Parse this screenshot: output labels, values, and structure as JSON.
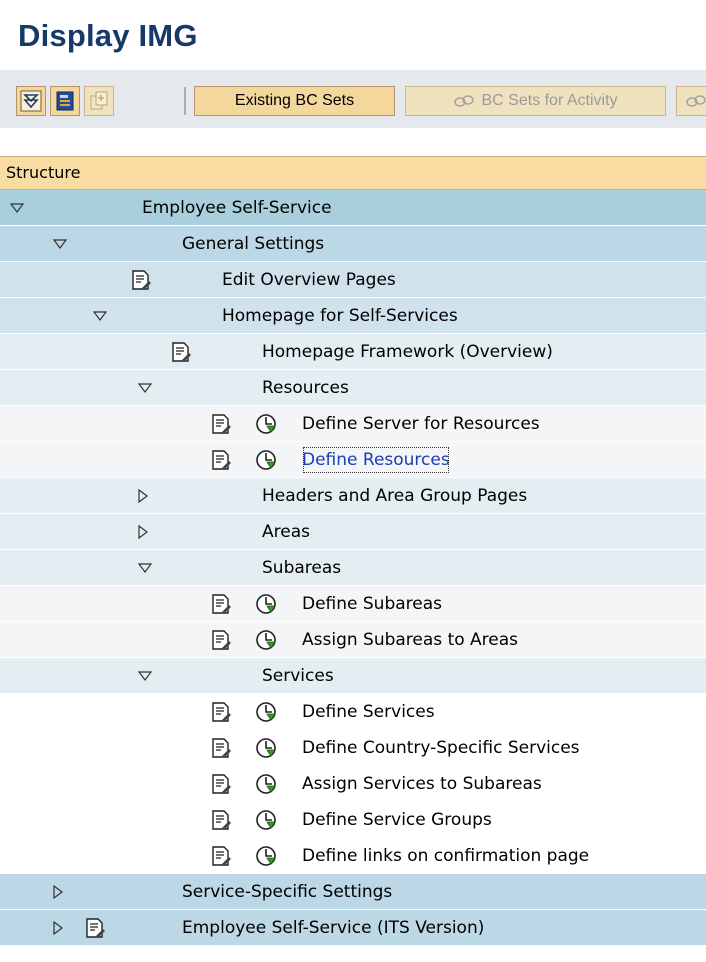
{
  "page": {
    "title": "Display IMG"
  },
  "toolbar": {
    "existing_bc_sets": "Existing BC Sets",
    "bc_sets_for_activity": "BC Sets for Activity"
  },
  "tree": {
    "header": "Structure",
    "rows": [
      {
        "label": "Employee Self-Service",
        "expander": "expanded",
        "doc": false,
        "exec": false
      },
      {
        "label": "General Settings",
        "expander": "expanded",
        "doc": false,
        "exec": false
      },
      {
        "label": "Edit Overview Pages",
        "expander": "none",
        "doc": true,
        "exec": false
      },
      {
        "label": "Homepage for Self-Services",
        "expander": "expanded",
        "doc": false,
        "exec": false
      },
      {
        "label": "Homepage Framework (Overview)",
        "expander": "none",
        "doc": true,
        "exec": false
      },
      {
        "label": "Resources",
        "expander": "expanded",
        "doc": false,
        "exec": false
      },
      {
        "label": "Define Server for Resources",
        "expander": "none",
        "doc": true,
        "exec": true
      },
      {
        "label": "Define Resources",
        "expander": "none",
        "doc": true,
        "exec": true,
        "selected": true
      },
      {
        "label": "Headers and Area Group Pages",
        "expander": "collapsed",
        "doc": false,
        "exec": false
      },
      {
        "label": "Areas",
        "expander": "collapsed",
        "doc": false,
        "exec": false
      },
      {
        "label": "Subareas",
        "expander": "expanded",
        "doc": false,
        "exec": false
      },
      {
        "label": "Define Subareas",
        "expander": "none",
        "doc": true,
        "exec": true
      },
      {
        "label": "Assign Subareas to Areas",
        "expander": "none",
        "doc": true,
        "exec": true
      },
      {
        "label": "Services",
        "expander": "expanded",
        "doc": false,
        "exec": false
      },
      {
        "label": "Define Services",
        "expander": "none",
        "doc": true,
        "exec": true
      },
      {
        "label": "Define Country-Specific Services",
        "expander": "none",
        "doc": true,
        "exec": true
      },
      {
        "label": "Assign Services to Subareas",
        "expander": "none",
        "doc": true,
        "exec": true
      },
      {
        "label": "Define Service Groups",
        "expander": "none",
        "doc": true,
        "exec": true
      },
      {
        "label": "Define links on confirmation page",
        "expander": "none",
        "doc": true,
        "exec": true
      },
      {
        "label": "Service-Specific Settings",
        "expander": "collapsed",
        "doc": false,
        "exec": false
      },
      {
        "label": "Employee Self-Service (ITS Version)",
        "expander": "collapsed",
        "doc": true,
        "exec": false
      }
    ]
  }
}
